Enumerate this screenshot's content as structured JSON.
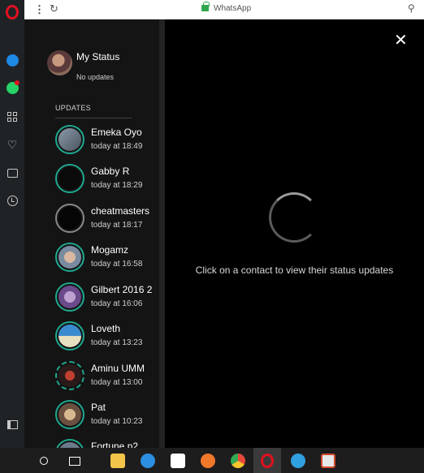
{
  "browser": {
    "address": "WhatsApp",
    "menu_icon": "more-vert-icon",
    "reload_icon": "reload-icon",
    "pin_icon": "pin-icon"
  },
  "opera_sidebar": {
    "items": [
      "opera-logo-icon",
      "messenger-icon",
      "whatsapp-icon",
      "speed-dial-icon",
      "heart-icon",
      "news-icon",
      "history-icon",
      "sidebar-toggle-icon"
    ]
  },
  "my_status": {
    "title": "My Status",
    "subtitle": "No updates"
  },
  "updates": {
    "label": "UPDATES",
    "items": [
      {
        "name": "Emeka Oyo",
        "time": "today at 18:49"
      },
      {
        "name": "Gabby R",
        "time": "today at 18:29"
      },
      {
        "name": "cheatmasters",
        "time": "today at 18:17"
      },
      {
        "name": "Mogamz",
        "time": "today at 16:58"
      },
      {
        "name": "Gilbert 2016 2",
        "time": "today at 16:06"
      },
      {
        "name": "Loveth",
        "time": "today at 13:23"
      },
      {
        "name": "Aminu UMM",
        "time": "today at 13:00"
      },
      {
        "name": "Pat",
        "time": "today at 10:23"
      },
      {
        "name": "Fortune p2",
        "time": ""
      }
    ]
  },
  "viewer": {
    "hint": "Click on a contact to view their status updates",
    "close_icon": "close-icon"
  },
  "colors": {
    "accent_ring": "#1fa890",
    "opera_red": "#e0111f",
    "panel_bg": "#141414"
  }
}
